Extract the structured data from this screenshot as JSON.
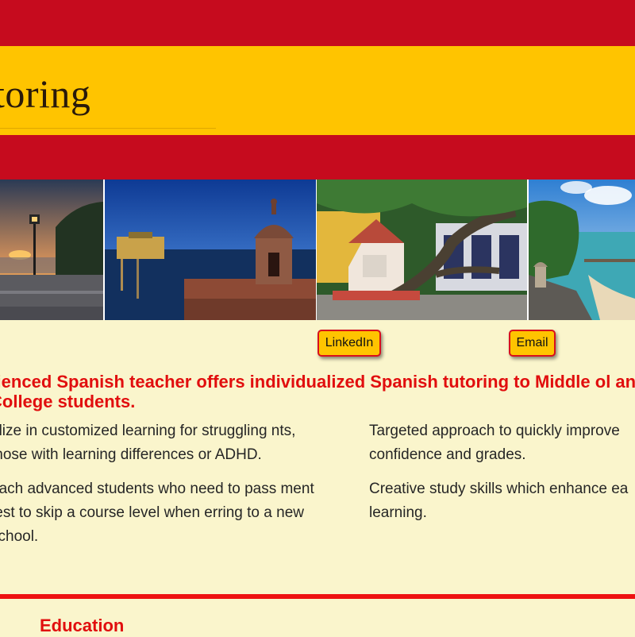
{
  "header": {
    "title": "toring"
  },
  "gallery": {
    "photos": [
      "sunset-lamppost-photo",
      "fortress-sentry-box-night-photo",
      "courtyard-tree-photo",
      "coastal-fort-beach-photo"
    ]
  },
  "buttons": {
    "linkedin": "LinkedIn",
    "email": "Email"
  },
  "intro": {
    "headline": "rienced Spanish teacher offers individualized Spanish tutoring to Middle ol and College students."
  },
  "left_column": {
    "paragraphs": [
      "alize in customized learning for struggling nts, those with learning differences or ADHD.",
      "each advanced students who need to pass ment test to skip a course level when erring to a new school."
    ]
  },
  "right_column": {
    "paragraphs": [
      "Targeted approach to quickly improve confidence and grades.",
      "Creative study skills which enhance ea learning."
    ]
  },
  "sections": {
    "education_title": "Education"
  },
  "colors": {
    "red": "#c60b1e",
    "yellow": "#ffc400",
    "background": "#faf5cc",
    "headline_red": "#e10e0e"
  }
}
